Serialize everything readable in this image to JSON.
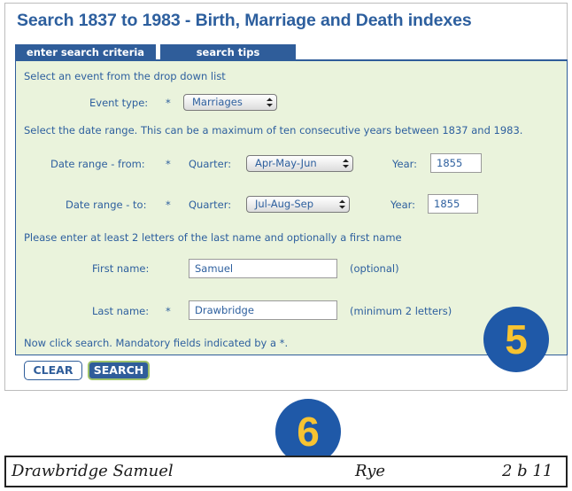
{
  "title": "Search 1837 to 1983 - Birth, Marriage and Death indexes",
  "tabs": [
    {
      "label": "enter search criteria"
    },
    {
      "label": "search tips"
    }
  ],
  "form": {
    "event_instruction": "Select an event from the drop down list",
    "event_type_label": "Event type:",
    "mandatory_marker": "*",
    "event_type_value": "Marriages",
    "date_instruction": "Select the date range. This can be a maximum of ten consecutive years between 1837 and 1983.",
    "date_from_label": "Date range - from:",
    "date_to_label": "Date range - to:",
    "quarter_label": "Quarter:",
    "year_label": "Year:",
    "from_quarter": "Apr-May-Jun",
    "from_year": "1855",
    "to_quarter": "Jul-Aug-Sep",
    "to_year": "1855",
    "name_instruction": "Please enter at least 2 letters of the last name and optionally a first name",
    "first_name_label": "First name:",
    "first_name_value": "Samuel",
    "first_name_hint": "(optional)",
    "last_name_label": "Last name:",
    "last_name_value": "Drawbridge",
    "last_name_hint": "(minimum 2 letters)",
    "footer_note": "Now click search. Mandatory fields indicated by a *."
  },
  "buttons": {
    "clear": "CLEAR",
    "search": "SEARCH"
  },
  "badges": {
    "five": "5",
    "six": "6"
  },
  "handwriting": {
    "name": "Drawbridge Samuel",
    "district": "Rye",
    "ref": "2 b 11"
  },
  "colors": {
    "brand_blue": "#2f5d9a",
    "form_bg": "#eaf3dc",
    "badge_bg": "#1f59a8",
    "badge_text": "#f7c331"
  }
}
